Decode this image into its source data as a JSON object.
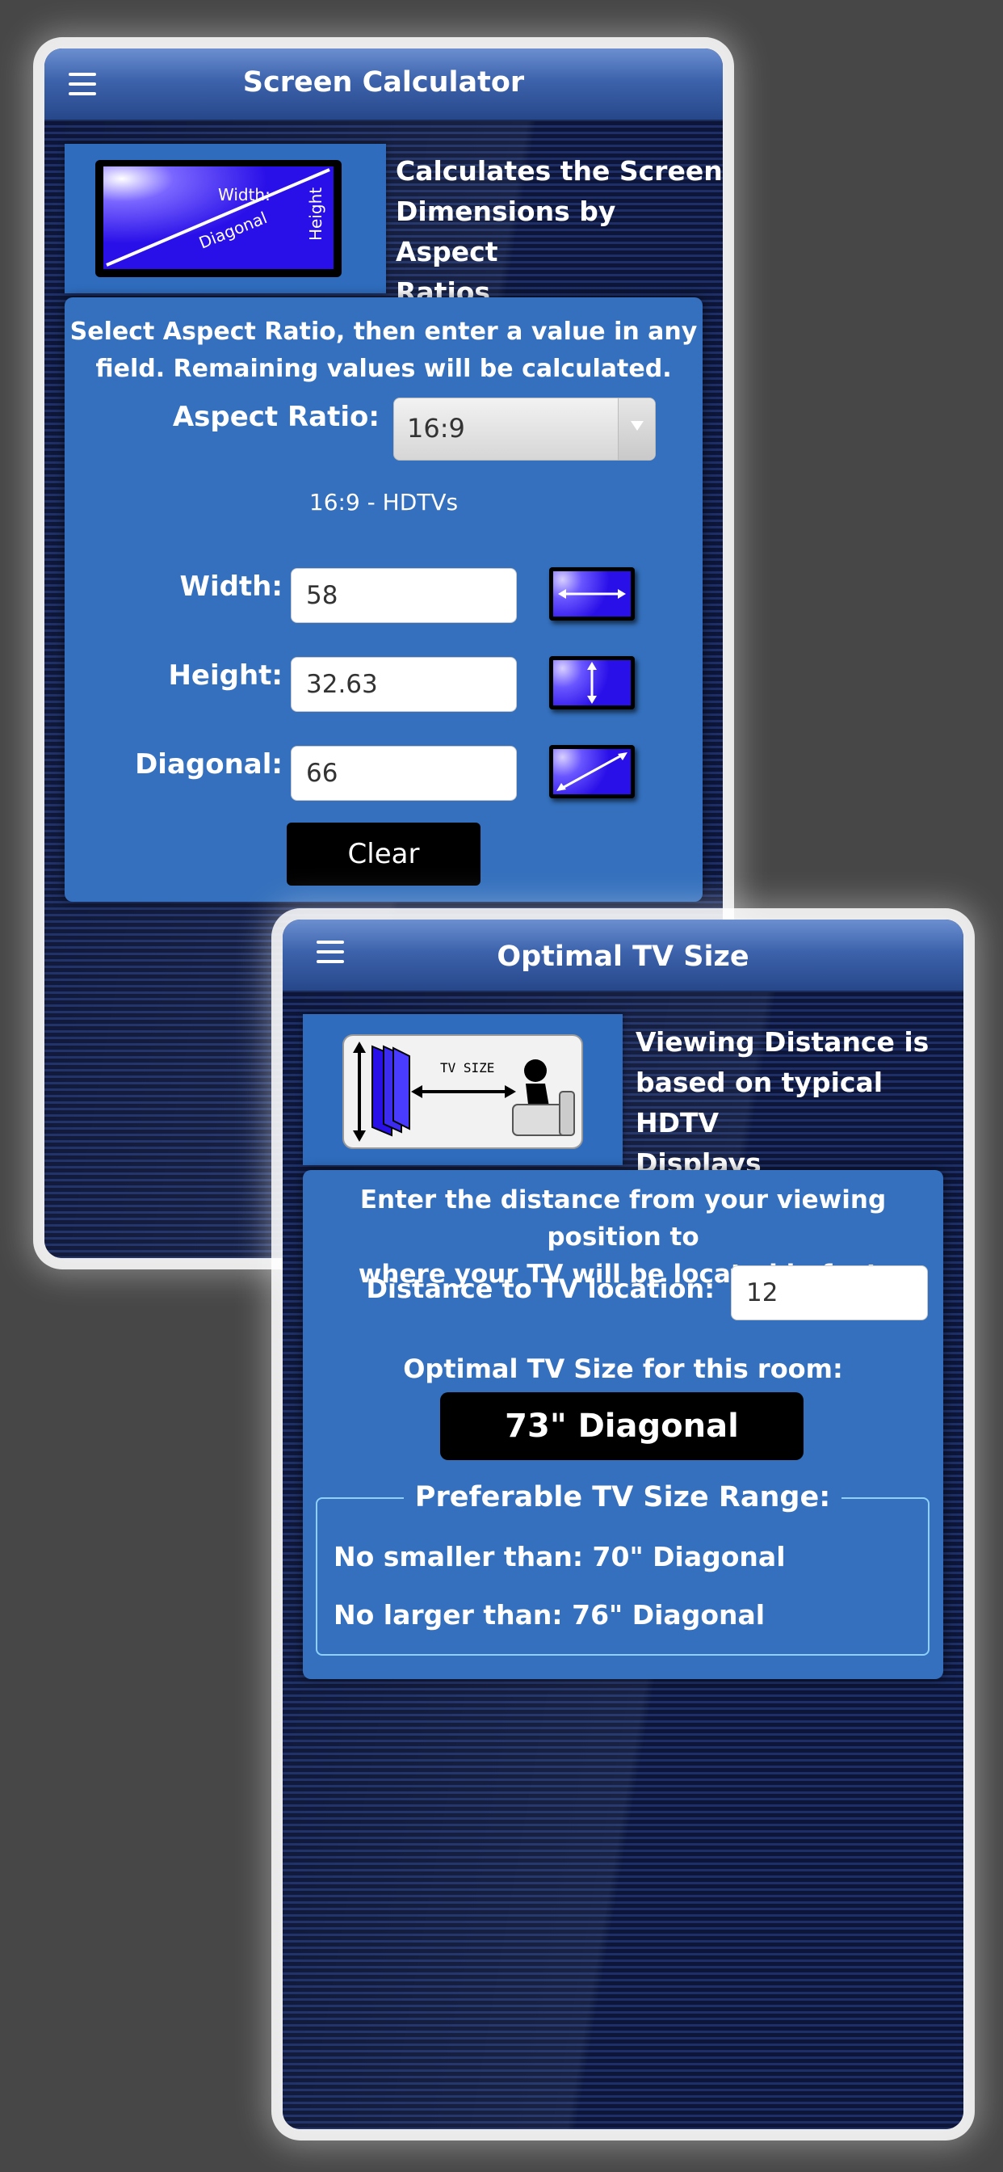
{
  "screen_calculator": {
    "title": "Screen Calculator",
    "hero_text": [
      "Calculates the Screen",
      "Dimensions by Aspect",
      "Ratios"
    ],
    "hero_image_labels": {
      "width": "Width:",
      "height": "Height",
      "diagonal": "Diagonal"
    },
    "intro": [
      "Select Aspect Ratio, then enter a value in any",
      "field. Remaining values will be calculated."
    ],
    "aspect_ratio_label": "Aspect Ratio:",
    "aspect_ratio_value": "16:9",
    "aspect_ratio_desc": "16:9 - HDTVs",
    "fields": [
      {
        "label": "Width:",
        "value": "58"
      },
      {
        "label": "Height:",
        "value": "32.63"
      },
      {
        "label": "Diagonal:",
        "value": "66"
      }
    ],
    "clear_label": "Clear"
  },
  "optimal_tv_size": {
    "title": "Optimal TV Size",
    "hero_text": [
      "Viewing Distance is",
      "based on typical HDTV",
      "Displays"
    ],
    "hero_image_label": "TV SIZE",
    "intro": [
      "Enter the distance from your viewing position to",
      "where your TV will be located in feet."
    ],
    "distance_label": "Distance to TV location:",
    "distance_value": "12",
    "result_title": "Optimal TV Size for this room:",
    "result_value": "73\" Diagonal",
    "range_title": "Preferable TV Size Range:",
    "range_min": "No smaller than: 70\" Diagonal",
    "range_max": "No larger than: 76\" Diagonal"
  },
  "colors": {
    "panel_blue": "#3470bd",
    "navbar_blue": "#3d63ac",
    "screen_violet": "#2a10e8",
    "range_border": "#8ed0ff"
  }
}
